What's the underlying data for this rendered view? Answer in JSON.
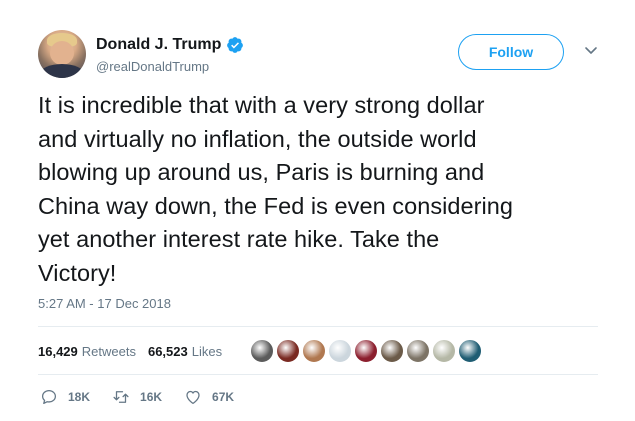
{
  "author": {
    "display_name": "Donald J. Trump",
    "handle": "@realDonaldTrump",
    "verified": true
  },
  "header": {
    "follow_label": "Follow"
  },
  "tweet": {
    "text": "It is incredible that with a very strong dollar\nand virtually no inflation, the outside world\nblowing up around us, Paris is burning and\nChina way down, the Fed is even considering\nyet another interest rate hike. Take the\nVictory!",
    "timestamp": "5:27 AM - 17 Dec 2018"
  },
  "stats": {
    "retweets_count": "16,429",
    "retweets_label": "Retweets",
    "likes_count": "66,523",
    "likes_label": "Likes"
  },
  "likers": [
    {
      "color": "#5b5b5b"
    },
    {
      "color": "#7a2a22"
    },
    {
      "color": "#b07850"
    },
    {
      "color": "#ccd6dd"
    },
    {
      "color": "#8c1f2e"
    },
    {
      "color": "#6b5a48"
    },
    {
      "color": "#7d7466"
    },
    {
      "color": "#b5b8a6"
    },
    {
      "color": "#1f5d73"
    }
  ],
  "actions": {
    "reply_count": "18K",
    "retweet_count": "16K",
    "like_count": "67K"
  },
  "colors": {
    "accent": "#1da1f2",
    "secondary_text": "#657786",
    "primary_text": "#14171a"
  }
}
